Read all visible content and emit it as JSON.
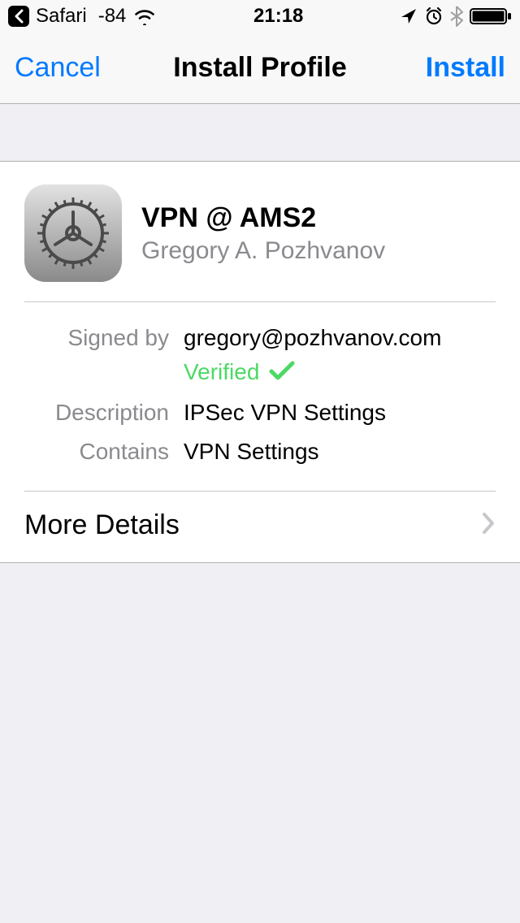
{
  "status_bar": {
    "back_app": "Safari",
    "signal": "-84",
    "time": "21:18"
  },
  "nav": {
    "cancel": "Cancel",
    "title": "Install Profile",
    "install": "Install"
  },
  "profile": {
    "title": "VPN @ AMS2",
    "subtitle": "Gregory A. Pozhvanov",
    "signed_by_label": "Signed by",
    "signed_by_value": "gregory@pozhvanov.com",
    "verified": "Verified",
    "description_label": "Description",
    "description_value": "IPSec VPN Settings",
    "contains_label": "Contains",
    "contains_value": "VPN Settings",
    "more_details": "More Details"
  }
}
